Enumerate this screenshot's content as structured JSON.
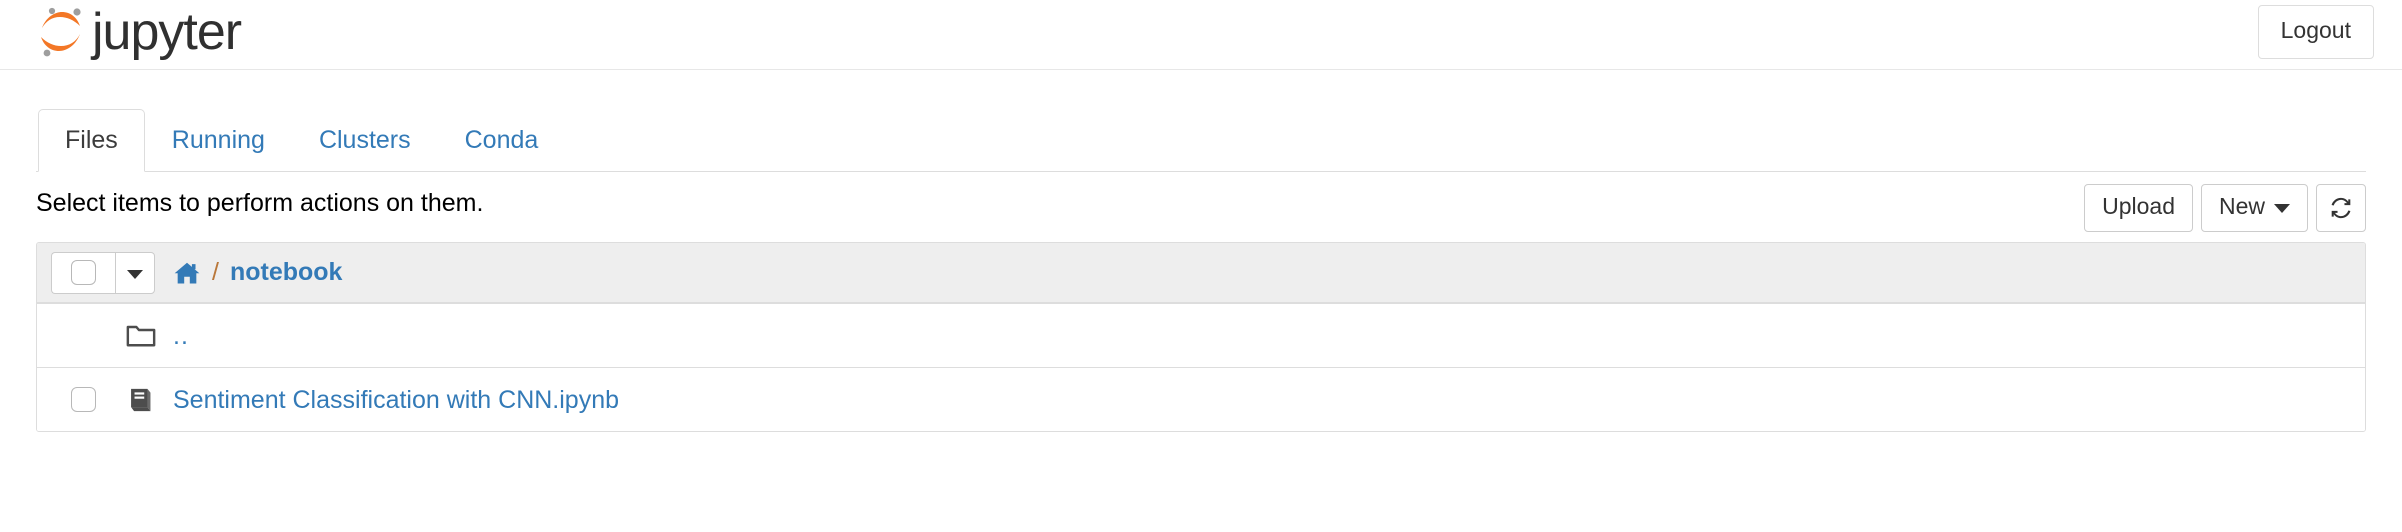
{
  "header": {
    "brand_text": "jupyter",
    "brand_icon": "jupyter-logo-icon",
    "logout_label": "Logout",
    "logo_colors": {
      "arc": "#f37726",
      "dot": "#9e9e9e",
      "wordmark": "#303030"
    }
  },
  "tabs": [
    {
      "label": "Files",
      "active": true
    },
    {
      "label": "Running",
      "active": false
    },
    {
      "label": "Clusters",
      "active": false
    },
    {
      "label": "Conda",
      "active": false
    }
  ],
  "toolbar": {
    "message": "Select items to perform actions on them.",
    "upload_label": "Upload",
    "new_label": "New",
    "new_caret_icon": "chevron-down-icon",
    "refresh_icon": "refresh-icon"
  },
  "breadcrumb": {
    "home_icon": "home-icon",
    "separator": "/",
    "path_label": "notebook",
    "select_all_icon": "checkbox-icon",
    "select_all_caret_icon": "chevron-down-icon"
  },
  "files": [
    {
      "name": "..",
      "icon": "folder-icon",
      "has_checkbox": false,
      "type": "directory"
    },
    {
      "name": "Sentiment Classification with CNN.ipynb",
      "icon": "notebook-icon",
      "has_checkbox": true,
      "type": "notebook"
    }
  ],
  "colors": {
    "link": "#337ab7",
    "header_bg": "#eeeeee",
    "border": "#dddddd",
    "text": "#333333"
  }
}
